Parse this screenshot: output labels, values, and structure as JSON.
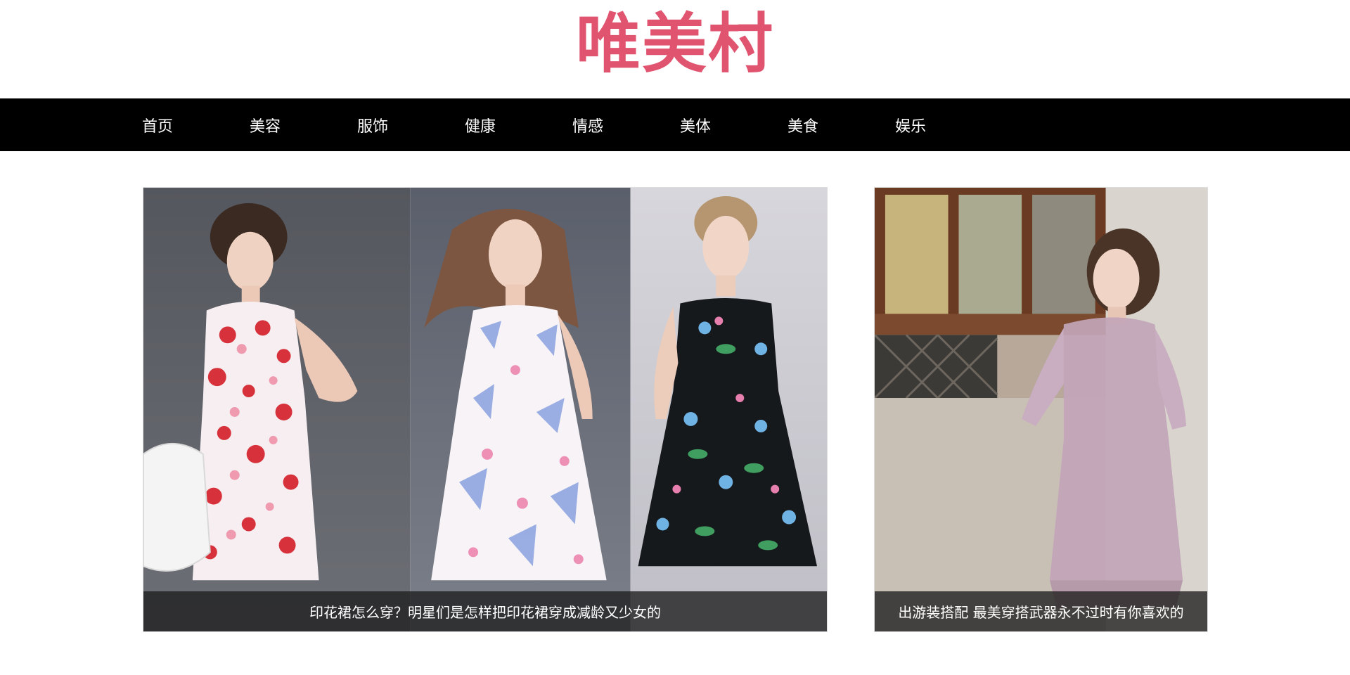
{
  "site": {
    "logo_text": "唯美村",
    "brand_color": "#e05470"
  },
  "nav": {
    "items": [
      {
        "label": "首页"
      },
      {
        "label": "美容"
      },
      {
        "label": "服饰"
      },
      {
        "label": "健康"
      },
      {
        "label": "情感"
      },
      {
        "label": "美体"
      },
      {
        "label": "美食"
      },
      {
        "label": "娱乐"
      }
    ]
  },
  "featured": {
    "main": {
      "caption": "印花裙怎么穿？明星们是怎样把印花裙穿成减龄又少女的",
      "image_icon": "three-models-floral-dresses-image"
    },
    "side": {
      "caption": "出游装搭配 最美穿搭武器永不过时有你喜欢的",
      "image_icon": "woman-lavender-romper-image"
    }
  }
}
